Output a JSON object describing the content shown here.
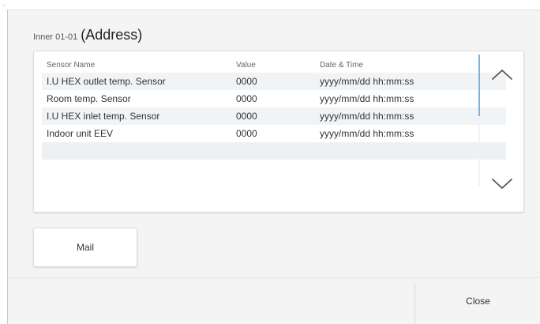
{
  "header": {
    "device_label": "Inner 01-01",
    "address_label": "(Address)"
  },
  "sensor_table": {
    "columns": {
      "name": "Sensor Name",
      "value": "Value",
      "datetime": "Date & Time"
    },
    "rows": [
      {
        "name": "I.U HEX outlet temp. Sensor",
        "value": "0000",
        "datetime": "yyyy/mm/dd hh:mm:ss"
      },
      {
        "name": "Room temp. Sensor",
        "value": "0000",
        "datetime": "yyyy/mm/dd hh:mm:ss"
      },
      {
        "name": "I.U HEX inlet temp. Sensor",
        "value": "0000",
        "datetime": "yyyy/mm/dd hh:mm:ss"
      },
      {
        "name": "Indoor unit EEV",
        "value": "0000",
        "datetime": "yyyy/mm/dd hh:mm:ss"
      }
    ]
  },
  "actions": {
    "mail_label": "Mail",
    "close_label": "Close"
  },
  "icons": {
    "scroll_up": "chevron-up-icon",
    "scroll_down": "chevron-down-icon"
  },
  "colors": {
    "background": "#f4f4f4",
    "panel": "#ffffff",
    "row_alt": "#f1f4f6",
    "scrollbar_thumb": "#7fb3dd",
    "text": "#333333"
  }
}
